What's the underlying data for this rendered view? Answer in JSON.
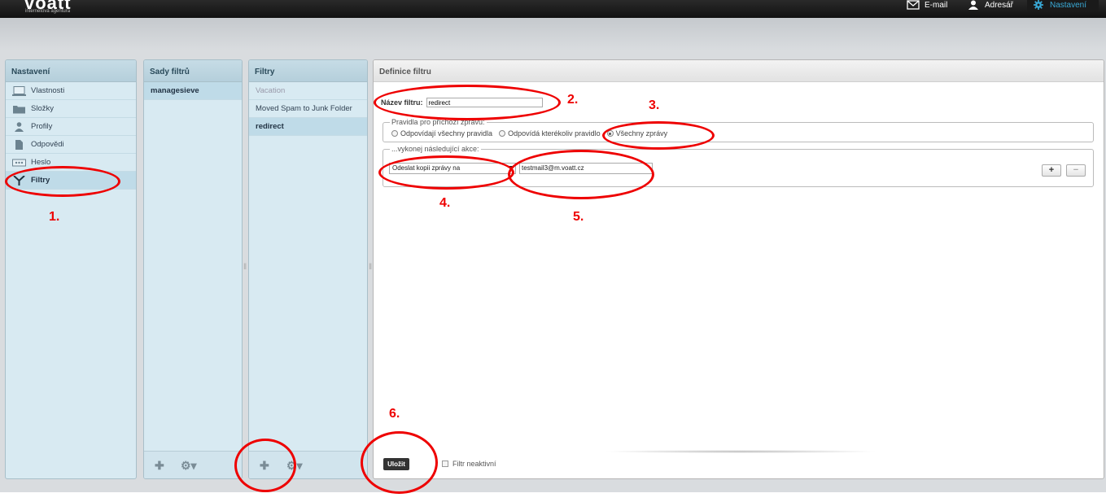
{
  "topbar": {
    "logo": "voatt",
    "logo_sub": "internetová agentura",
    "nav": [
      {
        "label": "E-mail",
        "icon": "mail-icon"
      },
      {
        "label": "Adresář",
        "icon": "person-icon"
      },
      {
        "label": "Nastavení",
        "icon": "gear-icon"
      }
    ]
  },
  "settings_panel": {
    "title": "Nastavení",
    "items": [
      {
        "label": "Vlastnosti",
        "icon": "laptop-icon"
      },
      {
        "label": "Složky",
        "icon": "folder-icon"
      },
      {
        "label": "Profily",
        "icon": "person-icon"
      },
      {
        "label": "Odpovědi",
        "icon": "document-icon"
      },
      {
        "label": "Heslo",
        "icon": "password-icon"
      },
      {
        "label": "Filtry",
        "icon": "filter-icon"
      }
    ]
  },
  "filter_sets_panel": {
    "title": "Sady filtrů",
    "items": [
      "managesieve"
    ]
  },
  "filters_panel": {
    "title": "Filtry",
    "items": [
      "Vacation",
      "Moved Spam to Junk Folder",
      "redirect"
    ]
  },
  "definition": {
    "title": "Definice filtru",
    "name_label": "Název filtru:",
    "name_value": "redirect",
    "rules_legend": "Pravidla pro příchozí zprávu:",
    "rule_options": [
      "Odpovídají všechny pravidla",
      "Odpovídá kterékoliv pravidlo",
      "Všechny zprávy"
    ],
    "rule_selected": "Všechny zprávy",
    "actions_legend": "...vykonej následující akce:",
    "action_value": "Odeslat kopii zprávy na",
    "action_target": "testmail3@m.voatt.cz",
    "add_label": "+",
    "remove_label": "−",
    "save_label": "Uložit",
    "inactive_label": "Filtr neaktivní"
  },
  "annotations": [
    "1.",
    "2.",
    "3.",
    "4.",
    "5.",
    "6."
  ],
  "colors": {
    "annotation": "#e00000",
    "accent": "#39a9d6"
  }
}
